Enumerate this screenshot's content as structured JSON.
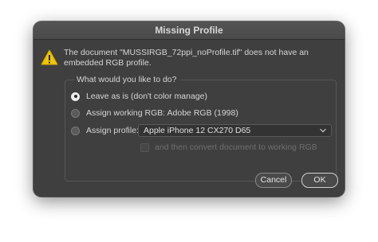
{
  "dialog": {
    "title": "Missing Profile",
    "message": "The document \"MUSSIRGB_72ppi_noProfile.tif\" does not have an embedded RGB profile.",
    "icon": "warning-icon",
    "warning_color": "#f2c500"
  },
  "options": {
    "legend": "What would you like to do?",
    "leave_as_is": "Leave as is (don't color manage)",
    "assign_working": "Assign working RGB:  Adobe RGB (1998)",
    "assign_profile": "Assign profile:",
    "profile_value": "Apple iPhone 12 CX270 D65",
    "convert_label": "and then convert document to working RGB",
    "selected": "leave_as_is"
  },
  "buttons": {
    "cancel": "Cancel",
    "ok": "OK"
  }
}
